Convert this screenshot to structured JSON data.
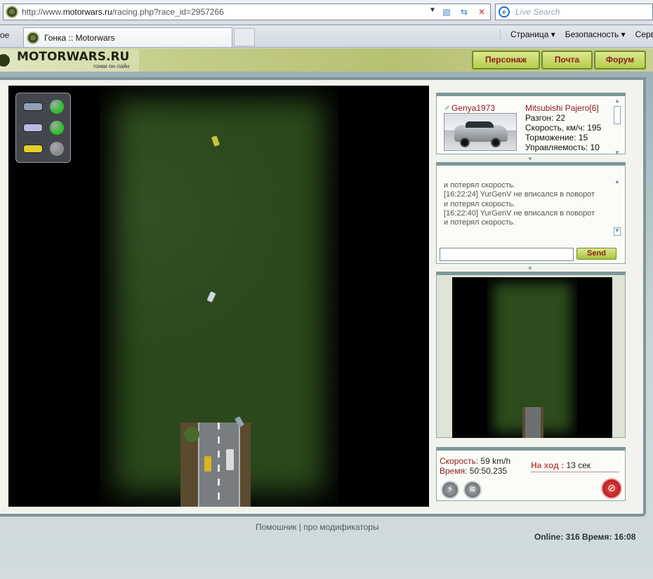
{
  "browser": {
    "url_prefix": "http://www.",
    "url_domain": "motorwars.ru",
    "url_path": "/racing.php?race_id=2957266",
    "search_placeholder": "Live Search",
    "prev_tab_label": "ое",
    "tab_title": "Гонка :: Motorwars",
    "commands": [
      "Страница ▾",
      "Безопасность ▾",
      "Серв"
    ]
  },
  "site": {
    "logo_name": "MOTORWARS.RU",
    "logo_sub": "гонки он-лайн",
    "nav": [
      "Персонаж",
      "Почта",
      "Форум"
    ]
  },
  "legend": {
    "rows": [
      {
        "car_color": "#8fa3b8",
        "status_color": "#2fbf2f"
      },
      {
        "car_color": "#b9b9e6",
        "status_color": "#2fbf2f"
      },
      {
        "car_color": "#e0d02a",
        "status_color": "#8a8a8a"
      }
    ]
  },
  "player": {
    "name": "Genya1973",
    "car_model": "Mitsubishi Pajero[6]",
    "stats": [
      "Разгон: 22",
      "Скорость, км/ч: 195",
      "Торможение: 15",
      "Управляемость: 10"
    ]
  },
  "chat": {
    "lines": [
      "и потерял скорость.",
      "[16:22:24] YurGenV не вписался в поворот",
      "и потерял скорость.",
      "[16:22:40] YurGenV не вписался в поворот",
      "и потерял скорость."
    ],
    "input_value": "",
    "send_label": "Send"
  },
  "race": {
    "speed_label": "Скорость:",
    "speed_value": "59 km/h",
    "time_label": "Время:",
    "time_value": "50:50.235",
    "turn_label": "На ход :",
    "turn_value": "13 сек"
  },
  "footer": {
    "links": "Помошник | про модификаторы",
    "online": "Online: 316  Время: 16:08"
  }
}
